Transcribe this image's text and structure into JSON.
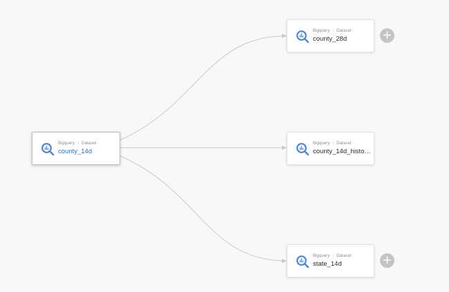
{
  "nodes": [
    {
      "id": "source",
      "source_type": "Bigquery",
      "kind": "Dataset",
      "name": "county_14d",
      "selected": true
    },
    {
      "id": "t1",
      "source_type": "Bigquery",
      "kind": "Dataset",
      "name": "county_28d"
    },
    {
      "id": "t2",
      "source_type": "Bigquery",
      "kind": "Dataset",
      "name": "county_14d_histo…"
    },
    {
      "id": "t3",
      "source_type": "Bigquery",
      "kind": "Dataset",
      "name": "state_14d"
    }
  ],
  "add_button_symbol": "+",
  "icons": {
    "dataset": "bigquery-icon"
  },
  "colors": {
    "edge": "#c9c9c9",
    "icon_blue": "#4a86e8",
    "selected_text": "#1a73e8",
    "add_button": "#c4c4c4",
    "background": "#f8f8f8"
  }
}
